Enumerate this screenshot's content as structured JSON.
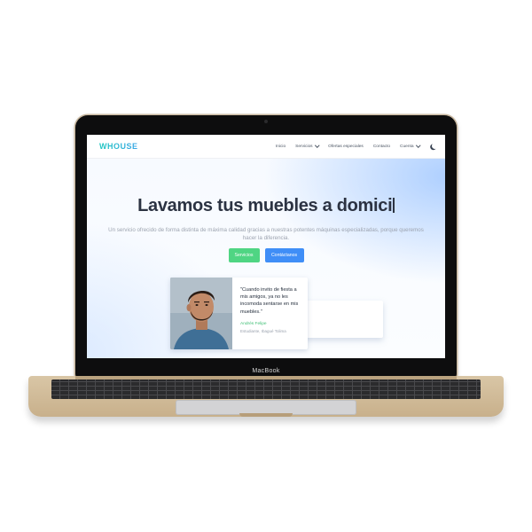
{
  "device": {
    "brand_label": "MacBook"
  },
  "site": {
    "logo": "WHOUSE",
    "nav": {
      "items": [
        {
          "label": "Inicio",
          "has_dropdown": false
        },
        {
          "label": "Servicios",
          "has_dropdown": true
        },
        {
          "label": "Ofertas especiales",
          "has_dropdown": false
        },
        {
          "label": "Contacto",
          "has_dropdown": false
        },
        {
          "label": "Cuenta",
          "has_dropdown": true
        }
      ],
      "theme_toggle_icon": "moon-icon"
    },
    "hero": {
      "headline": "Lavamos tus muebles a domici",
      "subtitle": "Un servicio ofrecido de forma distinta de máxima calidad gracias a nuestras potentes máquinas especializadas, porque queremos hacer la diferencia.",
      "primary_button": "Servicios",
      "secondary_button": "Contáctanos"
    },
    "testimonial": {
      "quote": "\"Cuando invito de fiesta a mis amigos, ya no les incomoda sentarse en mis muebles.\"",
      "author": "Andrés Felipe",
      "role": "Estudiante, Ibagué Tolima"
    },
    "floating_button_icon": "whatsapp-icon"
  },
  "colors": {
    "logo_gradient_start": "#1ec7c1",
    "logo_gradient_end": "#3ba6e8",
    "primary_green": "#4fd583",
    "primary_blue": "#3f8ef7",
    "headline": "#2c3342",
    "author_green": "#3fbf75",
    "laptop_gold": "#d9c6a6"
  }
}
